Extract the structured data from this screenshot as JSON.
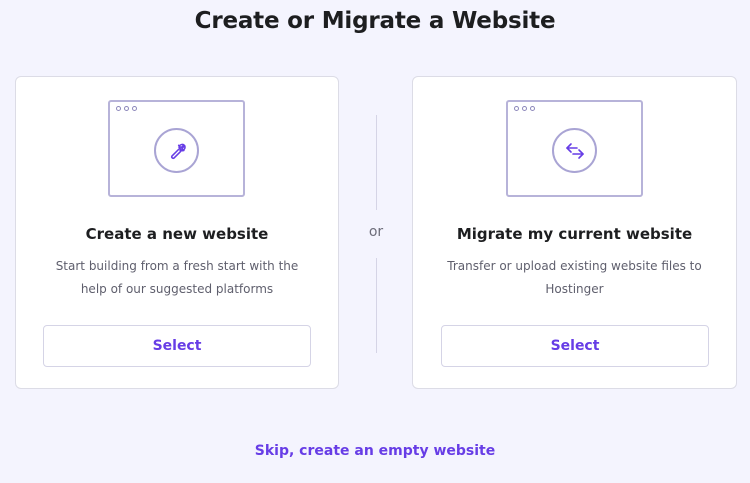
{
  "page": {
    "title": "Create or Migrate a Website"
  },
  "options": {
    "create": {
      "icon": "wrench-icon",
      "title": "Create a new website",
      "description": "Start building from a fresh start with the help of our suggested platforms",
      "button_label": "Select"
    },
    "migrate": {
      "icon": "transfer-arrows-icon",
      "title": "Migrate my current website",
      "description": "Transfer or upload existing website files to Hostinger",
      "button_label": "Select"
    }
  },
  "divider": {
    "label": "or"
  },
  "skip": {
    "label": "Skip, create an empty website"
  },
  "colors": {
    "accent": "#673de6",
    "background": "#f4f4fe",
    "heading": "#1d1e20",
    "muted_text": "#5f5f6d",
    "illustration_stroke": "#b7b3d9"
  }
}
